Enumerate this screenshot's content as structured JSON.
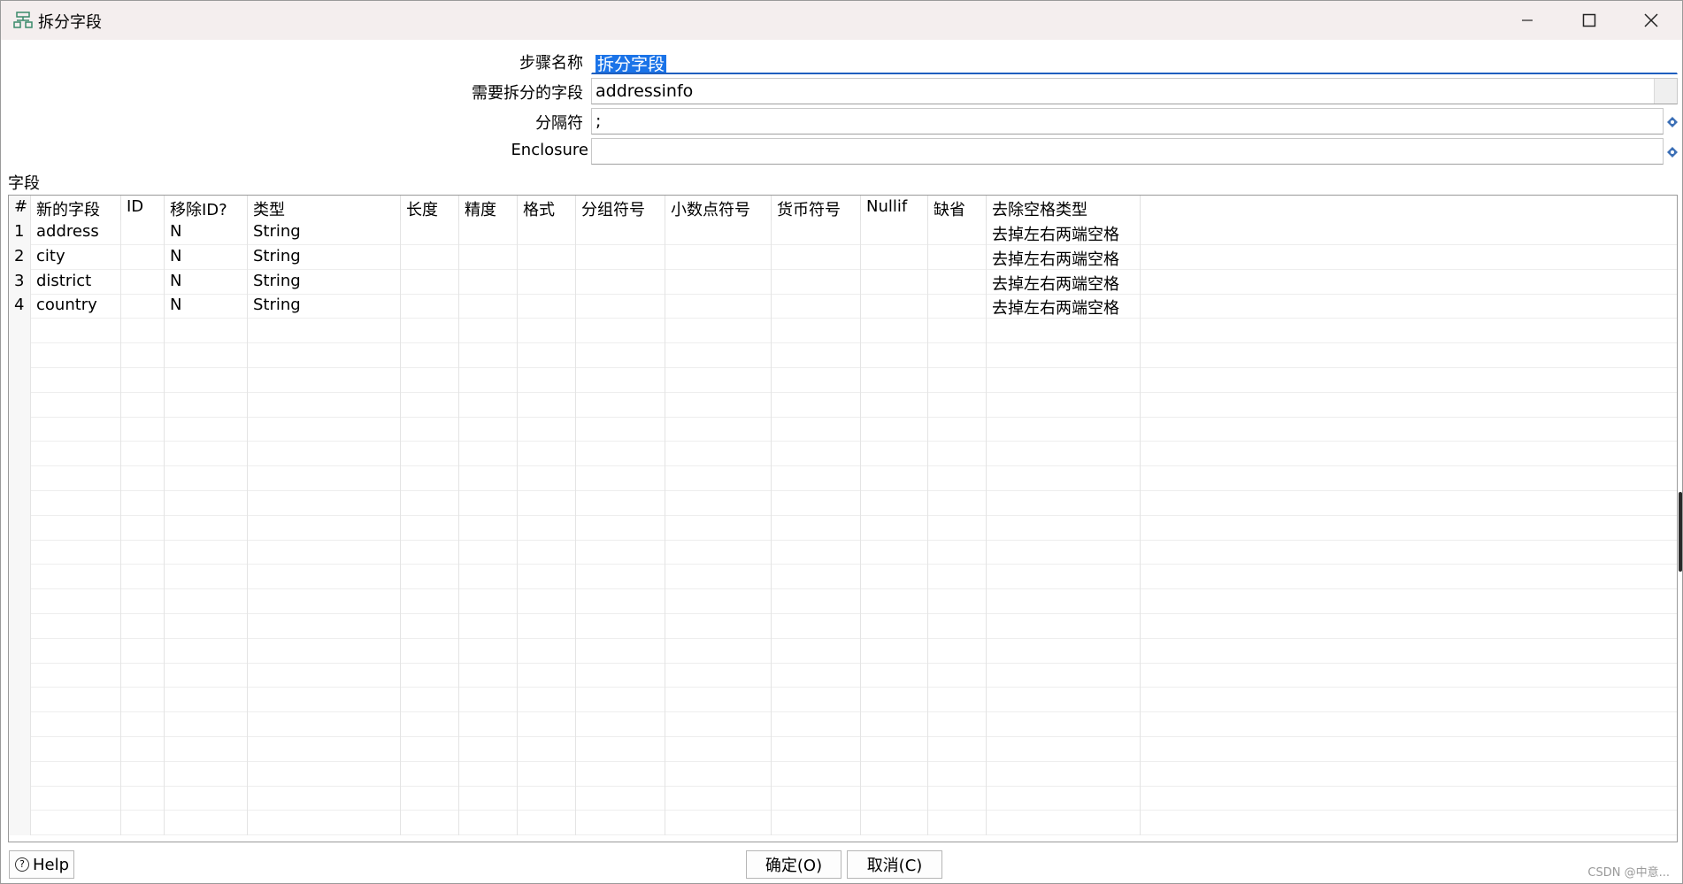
{
  "window": {
    "title": "拆分字段",
    "controls": {
      "minimize": "minimize-icon",
      "maximize": "maximize-icon",
      "close": "close-icon"
    }
  },
  "form": {
    "step_name": {
      "label": "步骤名称",
      "value": "拆分字段"
    },
    "field_to_split": {
      "label": "需要拆分的字段",
      "value": "addressinfo"
    },
    "delimiter": {
      "label": "分隔符",
      "value": ";"
    },
    "enclosure": {
      "label": "Enclosure",
      "value": ""
    }
  },
  "fields_section": {
    "label": "字段"
  },
  "table": {
    "columns": [
      "#",
      "新的字段",
      "ID",
      "移除ID?",
      "类型",
      "长度",
      "精度",
      "格式",
      "分组符号",
      "小数点符号",
      "货币符号",
      "Nullif",
      "缺省",
      "去除空格类型"
    ],
    "rows": [
      [
        "1",
        "address",
        "",
        "N",
        "String",
        "",
        "",
        "",
        "",
        "",
        "",
        "",
        "",
        "去掉左右两端空格"
      ],
      [
        "2",
        "city",
        "",
        "N",
        "String",
        "",
        "",
        "",
        "",
        "",
        "",
        "",
        "",
        "去掉左右两端空格"
      ],
      [
        "3",
        "district",
        "",
        "N",
        "String",
        "",
        "",
        "",
        "",
        "",
        "",
        "",
        "",
        "去掉左右两端空格"
      ],
      [
        "4",
        "country",
        "",
        "N",
        "String",
        "",
        "",
        "",
        "",
        "",
        "",
        "",
        "",
        "去掉左右两端空格"
      ]
    ]
  },
  "buttons": {
    "help": "Help",
    "ok": "确定(O)",
    "cancel": "取消(C)"
  },
  "watermark": "CSDN @中意...",
  "colors": {
    "title_bg": "#f4eeee",
    "selection": "#1a73e8",
    "focus_underline": "#1f5fbf"
  }
}
